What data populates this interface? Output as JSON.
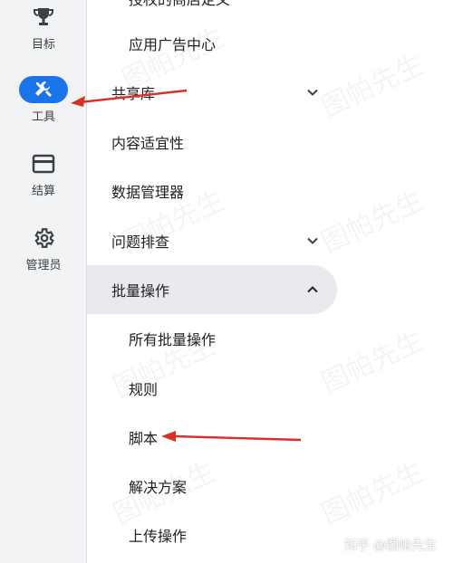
{
  "rail": {
    "items": [
      {
        "label": "目标",
        "icon": "trophy-icon"
      },
      {
        "label": "工具",
        "icon": "tools-icon",
        "active": true
      },
      {
        "label": "结算",
        "icon": "credit-card-icon"
      },
      {
        "label": "管理员",
        "icon": "gear-icon"
      }
    ]
  },
  "nav": {
    "partial_top": "授权的商店定义",
    "ad_center": "应用广告中心",
    "shared_library": "共享库",
    "content_suitability": "内容适宜性",
    "data_manager": "数据管理器",
    "troubleshooting": "问题排查",
    "bulk_actions": "批量操作",
    "sub": {
      "all_bulk": "所有批量操作",
      "rules": "规则",
      "scripts": "脚本",
      "solutions": "解决方案",
      "upload": "上传操作"
    }
  },
  "watermark": "图帕先生",
  "credit": "知乎 @图帕先生",
  "colors": {
    "accent": "#1a73e8",
    "rail_bg": "#f1f3f4",
    "expanded_bg": "#e8eaed",
    "annotation_arrow": "#d93025"
  }
}
